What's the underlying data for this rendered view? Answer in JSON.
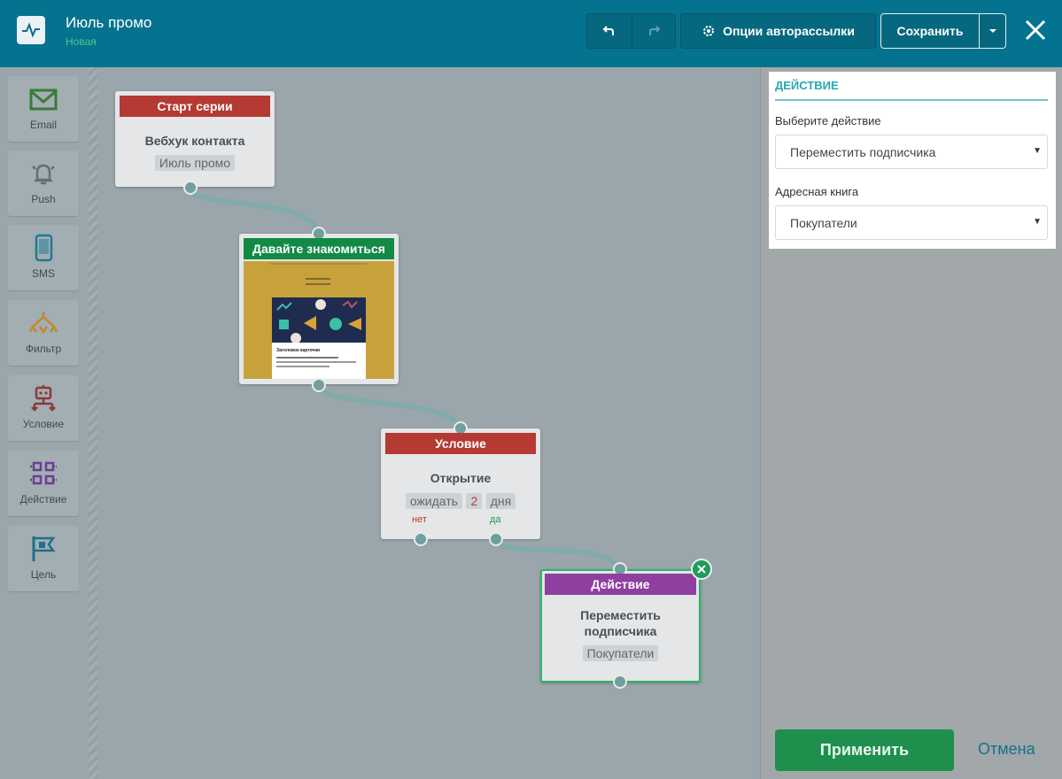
{
  "header": {
    "title": "Июль промо",
    "status": "Новая",
    "options_label": "Опции авторассылки",
    "save_label": "Сохранить"
  },
  "palette": {
    "items": [
      {
        "label": "Email",
        "icon": "envelope-icon",
        "color": "#3a7a38"
      },
      {
        "label": "Push",
        "icon": "bell-icon",
        "color": "#5e6e7a"
      },
      {
        "label": "SMS",
        "icon": "phone-icon",
        "color": "#1e7a94"
      },
      {
        "label": "Фильтр",
        "icon": "filter-icon",
        "color": "#c2872c"
      },
      {
        "label": "Условие",
        "icon": "condition-icon",
        "color": "#8a3b36"
      },
      {
        "label": "Действие",
        "icon": "action-icon",
        "color": "#6b3f8f"
      },
      {
        "label": "Цель",
        "icon": "flag-icon",
        "color": "#1f6f8f"
      }
    ]
  },
  "nodes": {
    "start": {
      "header": "Старт серии",
      "title": "Вебхук контакта",
      "tag": "Июль промо",
      "color": "#b53a33"
    },
    "email": {
      "header": "Давайте знакомиться",
      "color": "#128a45",
      "thumb_heading": "Заголовок карточки"
    },
    "condition": {
      "header": "Условие",
      "title": "Открытие",
      "wait_label": "ожидать",
      "wait_value": "2",
      "wait_unit": "дня",
      "no_label": "нет",
      "yes_label": "да",
      "color": "#b53a33"
    },
    "action": {
      "header": "Действие",
      "title_line1": "Переместить",
      "title_line2": "подписчика",
      "tag": "Покупатели",
      "color": "#8e3fa0"
    }
  },
  "panel": {
    "section_title": "ДЕЙСТВИЕ",
    "action_label": "Выберите действие",
    "action_value": "Переместить подписчика",
    "book_label": "Адресная книга",
    "book_value": "Покупатели",
    "apply_label": "Применить",
    "cancel_label": "Отмена"
  }
}
